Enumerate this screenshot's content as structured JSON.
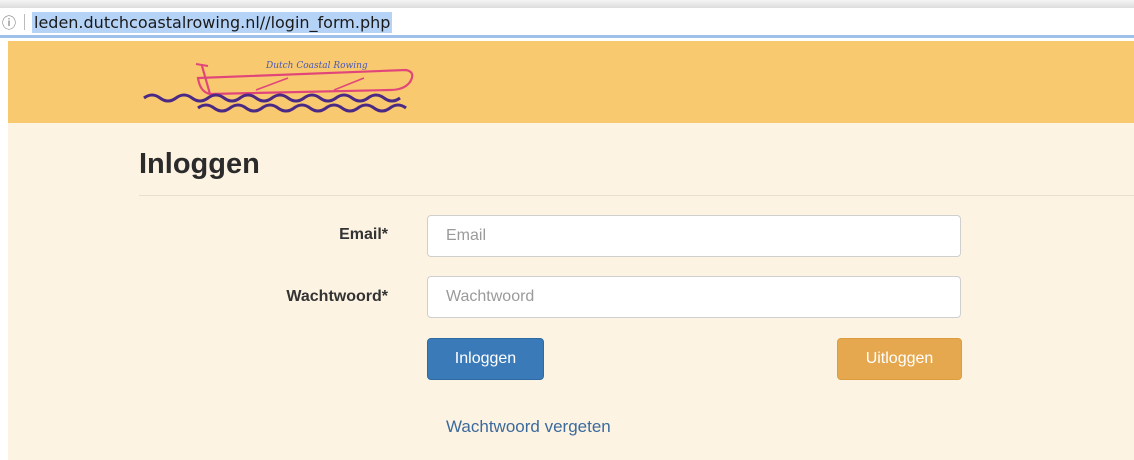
{
  "browser": {
    "info_icon": "info-icon",
    "url": "leden.dutchcoastalrowing.nl//login_form.php"
  },
  "header": {
    "logo_text": "Dutch Coastal Rowing",
    "background_color": "#f9c96f"
  },
  "page": {
    "title": "Inloggen",
    "background_color": "#fdf3e3"
  },
  "form": {
    "email_label": "Email*",
    "email_placeholder": "Email",
    "email_value": "",
    "password_label": "Wachtwoord*",
    "password_placeholder": "Wachtwoord",
    "password_value": "",
    "login_label": "Inloggen",
    "logout_label": "Uitloggen",
    "forgot_label": "Wachtwoord vergeten"
  },
  "colors": {
    "login_button": "#3a7ab8",
    "logout_button": "#e6a84e",
    "link": "#3b6a9c"
  }
}
